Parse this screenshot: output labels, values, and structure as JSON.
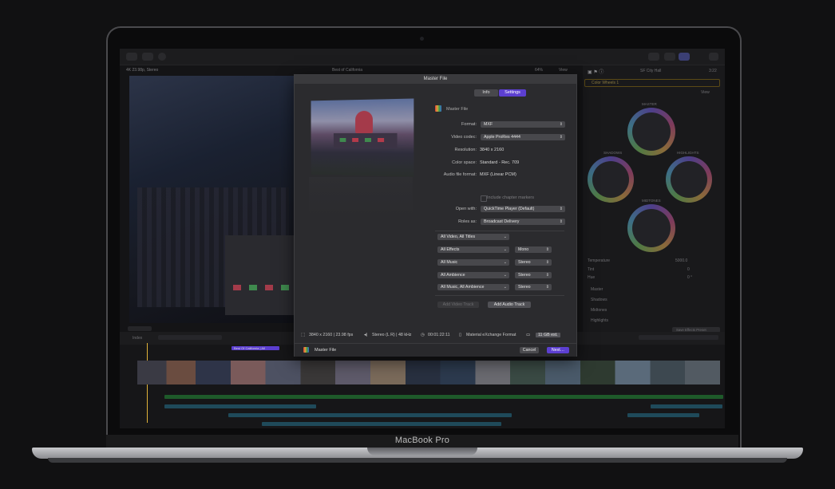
{
  "device": {
    "brand": "MacBook Pro"
  },
  "fcp": {
    "library_label": "4K 23.98p, Stereo",
    "project_title": "Best of California",
    "zoom": "64%",
    "view": "View",
    "inspector_title": "SF City Hall",
    "inspector_time": "3:22",
    "effect_name": "Color Wheels 1",
    "inspector_view": "View",
    "wheels": {
      "master": "MASTER",
      "shadows": "SHADOWS",
      "highlights": "HIGHLIGHTS",
      "midtones": "MIDTONES"
    },
    "params": [
      {
        "label": "Temperature",
        "value": "5000.0"
      },
      {
        "label": "Tint",
        "value": "0"
      },
      {
        "label": "Hue",
        "value": "0 °"
      }
    ],
    "inspector_groups": [
      "Master",
      "Shadows",
      "Midtones",
      "Highlights"
    ],
    "save_preset": "Save Effects Preset",
    "index": "Index",
    "timeline_label": "Best Of California | All"
  },
  "modal": {
    "title": "Master File",
    "tabs": [
      "Info",
      "Settings"
    ],
    "active_tab": "Settings",
    "file_name": "Master File",
    "fields": [
      {
        "label": "Format:",
        "value": "MXF",
        "control": "popup"
      },
      {
        "label": "Video codec:",
        "value": "Apple ProRes 4444",
        "control": "popup"
      },
      {
        "label": "Resolution:",
        "value": "3840 x 2160",
        "control": "text"
      },
      {
        "label": "Color space:",
        "value": "Standard - Rec. 709",
        "control": "text"
      },
      {
        "label": "Audio file format:",
        "value": "MXF (Linear PCM)",
        "control": "text"
      }
    ],
    "chapter_markers": "Include chapter markers",
    "open_with": {
      "label": "Open with:",
      "value": "QuickTime Player (Default)"
    },
    "roles_as": {
      "label": "Roles as:",
      "value": "Broadcast Delivery"
    },
    "roles": [
      {
        "role": "All Video, All Titles",
        "channel": ""
      },
      {
        "role": "All Effects",
        "channel": "Mono"
      },
      {
        "role": "All Music",
        "channel": "Stereo"
      },
      {
        "role": "All Ambience",
        "channel": "Stereo"
      },
      {
        "role": "All Music, All Ambience",
        "channel": "Stereo"
      }
    ],
    "add_video_track": "Add Video Track",
    "add_audio_track": "Add Audio Track",
    "status": {
      "resolution": "3840 x 2160 | 23.98 fps",
      "audio": "Stereo (L R) | 48 kHz",
      "duration": "00:01:22:11",
      "format": "Material eXchange Format",
      "size": "11 GB est."
    },
    "footer_title": "Master File",
    "cancel": "Cancel",
    "next": "Next…"
  },
  "colors": {
    "accent": "#5c3fd1",
    "modal_bg": "#2b2b2e",
    "green_lane": "#1e5a2a",
    "blue_lane": "#1f4a5a"
  }
}
